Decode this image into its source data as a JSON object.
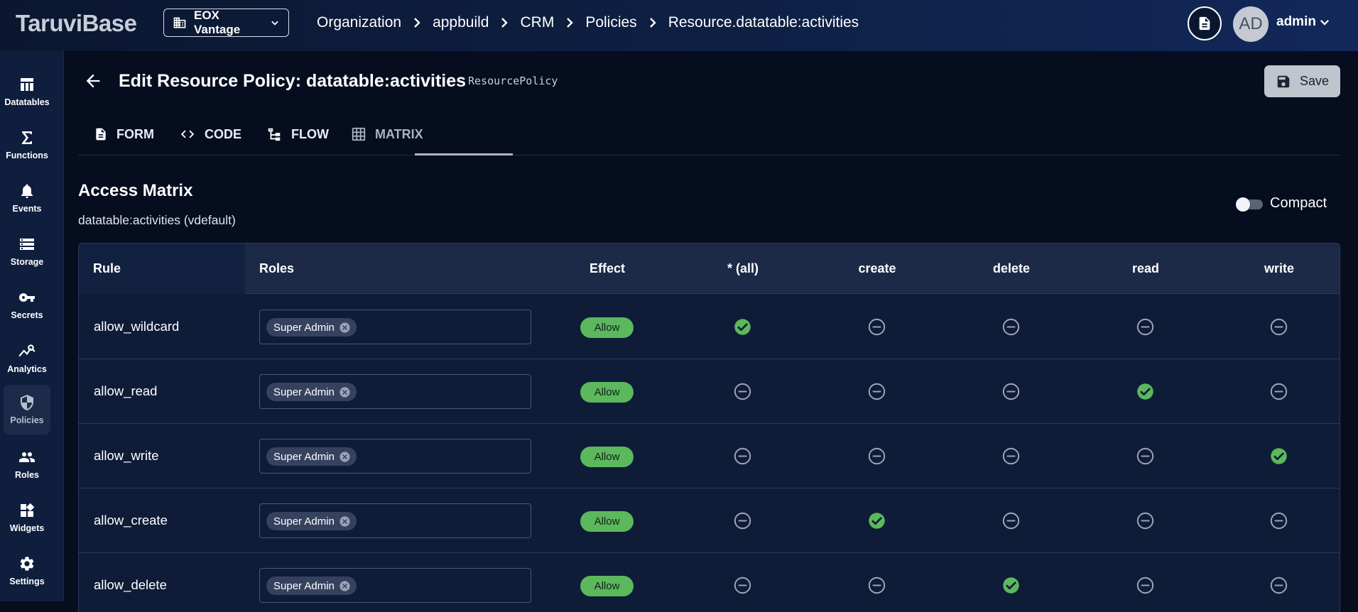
{
  "app": {
    "brand": "TaruviBase"
  },
  "header": {
    "org_select": "EOX Vantage",
    "breadcrumbs": [
      "Organization",
      "appbuild",
      "CRM",
      "Policies",
      "Resource.datatable:activities"
    ],
    "user": {
      "initials": "AD",
      "name": "admin"
    }
  },
  "sidebar": {
    "items": [
      {
        "label": "Datatables",
        "icon": "table-icon"
      },
      {
        "label": "Functions",
        "icon": "sigma-icon"
      },
      {
        "label": "Events",
        "icon": "bell-icon"
      },
      {
        "label": "Storage",
        "icon": "storage-icon"
      },
      {
        "label": "Secrets",
        "icon": "key-icon"
      },
      {
        "label": "Analytics",
        "icon": "analytics-icon"
      },
      {
        "label": "Policies",
        "icon": "shield-icon",
        "active": true
      },
      {
        "label": "Roles",
        "icon": "people-icon"
      },
      {
        "label": "Widgets",
        "icon": "widgets-icon"
      },
      {
        "label": "Settings",
        "icon": "gear-icon"
      }
    ]
  },
  "page": {
    "title": "Edit Resource Policy: datatable:activities",
    "policy_type": "ResourcePolicy",
    "save_label": "Save"
  },
  "tabs": [
    {
      "label": "FORM",
      "icon": "document-icon"
    },
    {
      "label": "CODE",
      "icon": "code-icon"
    },
    {
      "label": "FLOW",
      "icon": "flow-icon"
    },
    {
      "label": "MATRIX",
      "icon": "grid-icon",
      "active": true
    }
  ],
  "matrix": {
    "title": "Access Matrix",
    "subtitle": "datatable:activities (vdefault)",
    "compact_label": "Compact",
    "compact_on": false,
    "columns": {
      "rule": "Rule",
      "roles": "Roles",
      "effect": "Effect"
    },
    "actions": [
      "* (all)",
      "create",
      "delete",
      "read",
      "write"
    ],
    "rows": [
      {
        "rule": "allow_wildcard",
        "role": "Super Admin",
        "effect": "Allow",
        "perms": [
          true,
          false,
          false,
          false,
          false
        ]
      },
      {
        "rule": "allow_read",
        "role": "Super Admin",
        "effect": "Allow",
        "perms": [
          false,
          false,
          false,
          true,
          false
        ]
      },
      {
        "rule": "allow_write",
        "role": "Super Admin",
        "effect": "Allow",
        "perms": [
          false,
          false,
          false,
          false,
          true
        ]
      },
      {
        "rule": "allow_create",
        "role": "Super Admin",
        "effect": "Allow",
        "perms": [
          false,
          true,
          false,
          false,
          false
        ]
      },
      {
        "rule": "allow_delete",
        "role": "Super Admin",
        "effect": "Allow",
        "perms": [
          false,
          false,
          true,
          false,
          false
        ]
      }
    ]
  },
  "colors": {
    "allow_green": "#5cb85c",
    "check_green": "#5cb85c",
    "neutral_icon": "#9aa3b5"
  }
}
